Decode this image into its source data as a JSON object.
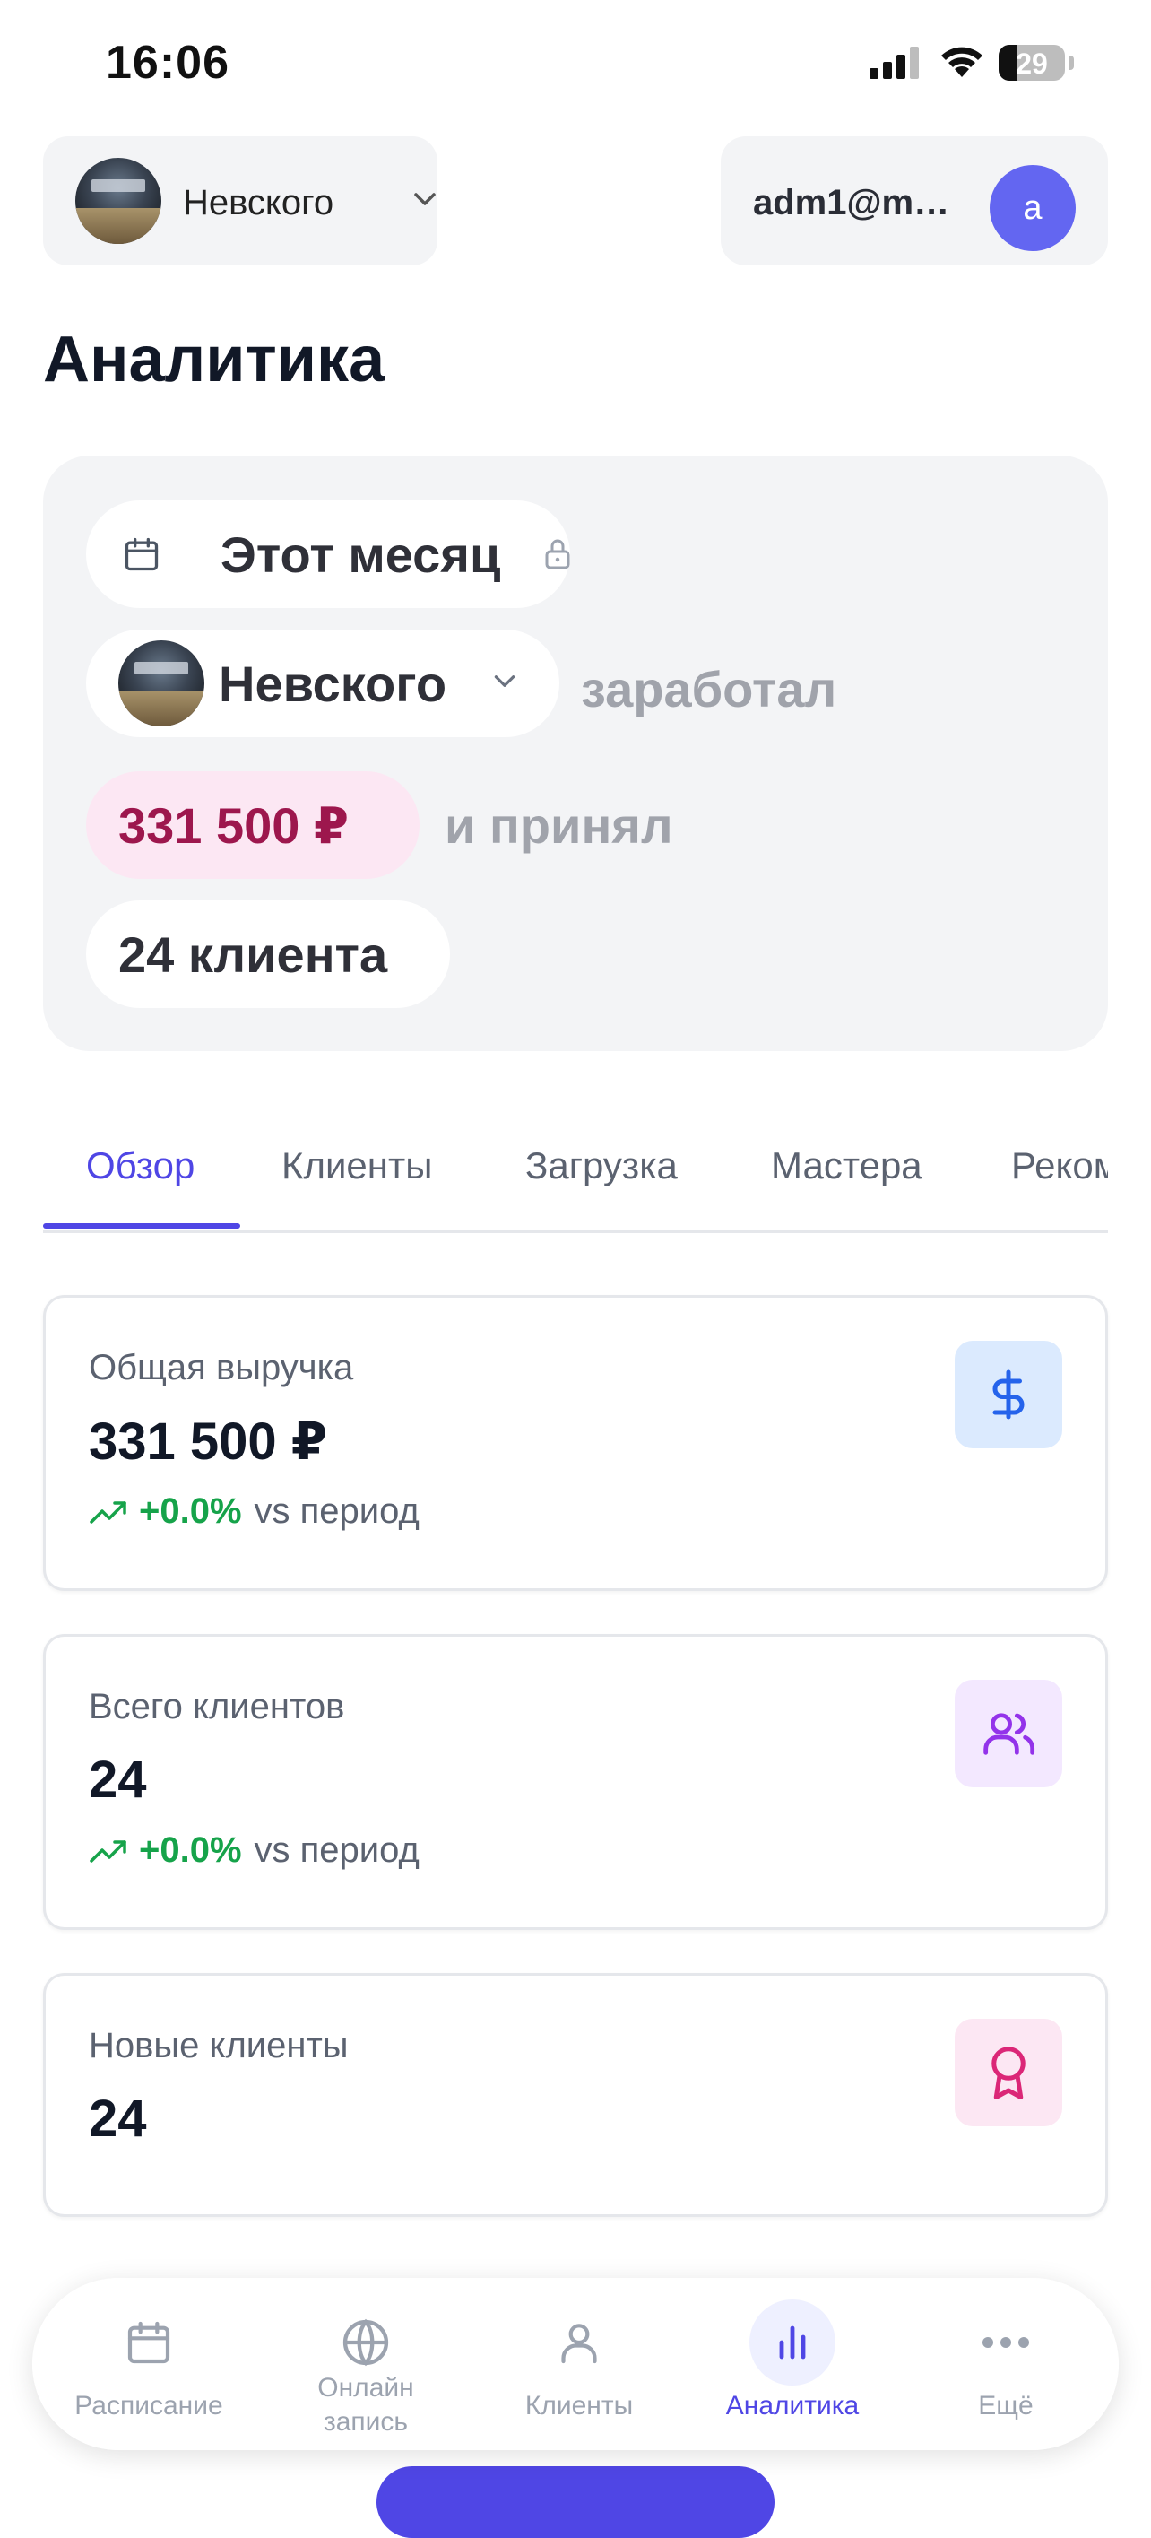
{
  "status_bar": {
    "time": "16:06",
    "battery": "29",
    "battery_level": 0.29
  },
  "header": {
    "branch": "Невского",
    "account_email": "adm1@m…",
    "account_initial": "a"
  },
  "page": {
    "title": "Аналитика"
  },
  "summary": {
    "period": "Этот месяц",
    "branch": "Невского",
    "earned_text": "заработал",
    "amount": "331 500 ₽",
    "accepted_text": "и принял",
    "clients": "24 клиента"
  },
  "tabs": [
    {
      "label": "Обзор",
      "active": true
    },
    {
      "label": "Клиенты"
    },
    {
      "label": "Загрузка"
    },
    {
      "label": "Мастера"
    },
    {
      "label": "Рекомендации"
    }
  ],
  "stats": {
    "revenue": {
      "label": "Общая выручка",
      "value": "331 500 ₽",
      "trend": "+0.0%",
      "trend_suffix": "vs период",
      "icon": "dollar-icon",
      "color": "#dbeafe"
    },
    "total_clients": {
      "label": "Всего клиентов",
      "value": "24",
      "trend": "+0.0%",
      "trend_suffix": "vs период",
      "icon": "users-icon",
      "color": "#f3e8ff"
    },
    "new_clients": {
      "label": "Новые клиенты",
      "value": "24",
      "icon": "award-icon",
      "color": "#fce7f3"
    }
  },
  "bottom_nav": {
    "schedule": "Расписание",
    "online_line1": "Онлайн",
    "online_line2": "запись",
    "clients": "Клиенты",
    "analytics": "Аналитика",
    "more": "Ещё"
  },
  "colors": {
    "accent": "#4f46e5",
    "positive": "#16a34a",
    "amount_text": "#9d174d"
  }
}
